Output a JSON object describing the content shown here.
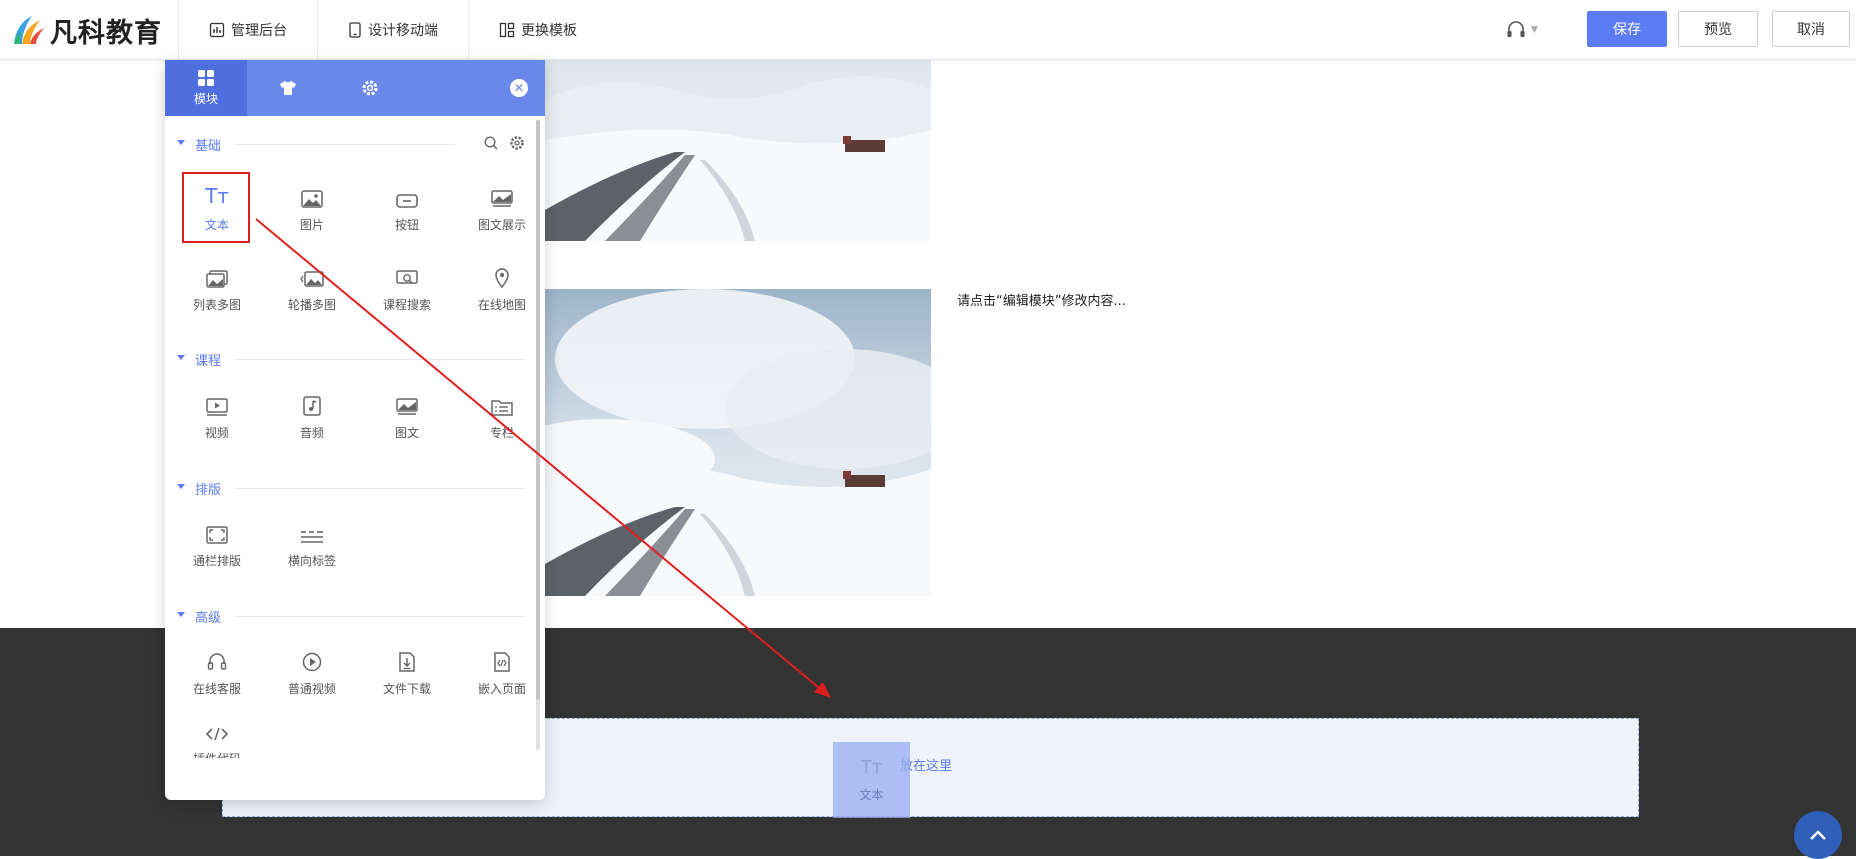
{
  "header": {
    "logo_text": "凡科教育",
    "nav": [
      {
        "label": "管理后台",
        "icon": "chart-icon"
      },
      {
        "label": "设计移动端",
        "icon": "mobile-icon"
      },
      {
        "label": "更换模板",
        "icon": "layout-icon"
      }
    ],
    "save_label": "保存",
    "preview_label": "预览",
    "cancel_label": "取消"
  },
  "panel": {
    "tabs": [
      {
        "label": "模块",
        "icon": "grid-icon",
        "active": true
      },
      {
        "label": "",
        "icon": "shirt-icon",
        "active": false
      },
      {
        "label": "",
        "icon": "gear-icon",
        "active": false
      }
    ],
    "sections": [
      {
        "title": "基础",
        "items": [
          {
            "label": "文本",
            "icon": "text-icon"
          },
          {
            "label": "图片",
            "icon": "image-icon"
          },
          {
            "label": "按钮",
            "icon": "button-icon"
          },
          {
            "label": "图文展示",
            "icon": "image-text-icon"
          },
          {
            "label": "列表多图",
            "icon": "list-images-icon"
          },
          {
            "label": "轮播多图",
            "icon": "carousel-icon"
          },
          {
            "label": "课程搜索",
            "icon": "course-search-icon"
          },
          {
            "label": "在线地图",
            "icon": "map-pin-icon"
          }
        ]
      },
      {
        "title": "课程",
        "items": [
          {
            "label": "视频",
            "icon": "video-icon"
          },
          {
            "label": "音频",
            "icon": "audio-icon"
          },
          {
            "label": "图文",
            "icon": "graphic-icon"
          },
          {
            "label": "专栏",
            "icon": "column-icon"
          }
        ]
      },
      {
        "title": "排版",
        "items": [
          {
            "label": "通栏排版",
            "icon": "full-width-icon"
          },
          {
            "label": "横向标签",
            "icon": "horizontal-tabs-icon"
          }
        ]
      },
      {
        "title": "高级",
        "items": [
          {
            "label": "在线客服",
            "icon": "headset-icon"
          },
          {
            "label": "普通视频",
            "icon": "play-circle-icon"
          },
          {
            "label": "文件下载",
            "icon": "file-download-icon"
          },
          {
            "label": "嵌入页面",
            "icon": "embed-page-icon"
          },
          {
            "label": "插件代码",
            "icon": "code-icon"
          }
        ]
      }
    ]
  },
  "canvas": {
    "hint_text": "请点击“编辑模块”修改内容...",
    "drop_text": "放在这里",
    "drag_ghost_label": "文本"
  },
  "colors": {
    "primary": "#5b7cf2",
    "panel_header": "#6a87ea",
    "highlight": "#e02020",
    "footer": "#333333"
  }
}
